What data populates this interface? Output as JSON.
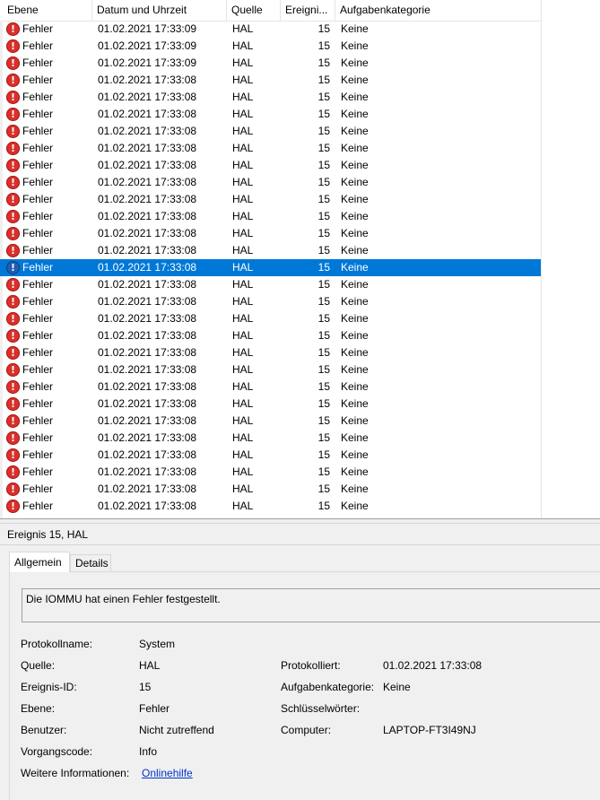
{
  "list": {
    "columns": [
      "Ebene",
      "Datum und Uhrzeit",
      "Quelle",
      "Ereigni...",
      "Aufgabenkategorie"
    ],
    "selected_index": 14,
    "rows": [
      {
        "level": "Fehler",
        "date": "01.02.2021 17:33:09",
        "source": "HAL",
        "id": "15",
        "category": "Keine"
      },
      {
        "level": "Fehler",
        "date": "01.02.2021 17:33:09",
        "source": "HAL",
        "id": "15",
        "category": "Keine"
      },
      {
        "level": "Fehler",
        "date": "01.02.2021 17:33:09",
        "source": "HAL",
        "id": "15",
        "category": "Keine"
      },
      {
        "level": "Fehler",
        "date": "01.02.2021 17:33:08",
        "source": "HAL",
        "id": "15",
        "category": "Keine"
      },
      {
        "level": "Fehler",
        "date": "01.02.2021 17:33:08",
        "source": "HAL",
        "id": "15",
        "category": "Keine"
      },
      {
        "level": "Fehler",
        "date": "01.02.2021 17:33:08",
        "source": "HAL",
        "id": "15",
        "category": "Keine"
      },
      {
        "level": "Fehler",
        "date": "01.02.2021 17:33:08",
        "source": "HAL",
        "id": "15",
        "category": "Keine"
      },
      {
        "level": "Fehler",
        "date": "01.02.2021 17:33:08",
        "source": "HAL",
        "id": "15",
        "category": "Keine"
      },
      {
        "level": "Fehler",
        "date": "01.02.2021 17:33:08",
        "source": "HAL",
        "id": "15",
        "category": "Keine"
      },
      {
        "level": "Fehler",
        "date": "01.02.2021 17:33:08",
        "source": "HAL",
        "id": "15",
        "category": "Keine"
      },
      {
        "level": "Fehler",
        "date": "01.02.2021 17:33:08",
        "source": "HAL",
        "id": "15",
        "category": "Keine"
      },
      {
        "level": "Fehler",
        "date": "01.02.2021 17:33:08",
        "source": "HAL",
        "id": "15",
        "category": "Keine"
      },
      {
        "level": "Fehler",
        "date": "01.02.2021 17:33:08",
        "source": "HAL",
        "id": "15",
        "category": "Keine"
      },
      {
        "level": "Fehler",
        "date": "01.02.2021 17:33:08",
        "source": "HAL",
        "id": "15",
        "category": "Keine"
      },
      {
        "level": "Fehler",
        "date": "01.02.2021 17:33:08",
        "source": "HAL",
        "id": "15",
        "category": "Keine"
      },
      {
        "level": "Fehler",
        "date": "01.02.2021 17:33:08",
        "source": "HAL",
        "id": "15",
        "category": "Keine"
      },
      {
        "level": "Fehler",
        "date": "01.02.2021 17:33:08",
        "source": "HAL",
        "id": "15",
        "category": "Keine"
      },
      {
        "level": "Fehler",
        "date": "01.02.2021 17:33:08",
        "source": "HAL",
        "id": "15",
        "category": "Keine"
      },
      {
        "level": "Fehler",
        "date": "01.02.2021 17:33:08",
        "source": "HAL",
        "id": "15",
        "category": "Keine"
      },
      {
        "level": "Fehler",
        "date": "01.02.2021 17:33:08",
        "source": "HAL",
        "id": "15",
        "category": "Keine"
      },
      {
        "level": "Fehler",
        "date": "01.02.2021 17:33:08",
        "source": "HAL",
        "id": "15",
        "category": "Keine"
      },
      {
        "level": "Fehler",
        "date": "01.02.2021 17:33:08",
        "source": "HAL",
        "id": "15",
        "category": "Keine"
      },
      {
        "level": "Fehler",
        "date": "01.02.2021 17:33:08",
        "source": "HAL",
        "id": "15",
        "category": "Keine"
      },
      {
        "level": "Fehler",
        "date": "01.02.2021 17:33:08",
        "source": "HAL",
        "id": "15",
        "category": "Keine"
      },
      {
        "level": "Fehler",
        "date": "01.02.2021 17:33:08",
        "source": "HAL",
        "id": "15",
        "category": "Keine"
      },
      {
        "level": "Fehler",
        "date": "01.02.2021 17:33:08",
        "source": "HAL",
        "id": "15",
        "category": "Keine"
      },
      {
        "level": "Fehler",
        "date": "01.02.2021 17:33:08",
        "source": "HAL",
        "id": "15",
        "category": "Keine"
      },
      {
        "level": "Fehler",
        "date": "01.02.2021 17:33:08",
        "source": "HAL",
        "id": "15",
        "category": "Keine"
      },
      {
        "level": "Fehler",
        "date": "01.02.2021 17:33:08",
        "source": "HAL",
        "id": "15",
        "category": "Keine"
      }
    ],
    "error_icon": "error-icon",
    "selection_color": "#0078d7"
  },
  "detail": {
    "title": "Ereignis 15, HAL",
    "tabs": [
      "Allgemein",
      "Details"
    ],
    "active_tab": "Allgemein",
    "description": "Die IOMMU hat einen Fehler festgestellt.",
    "labels": {
      "log_name": "Protokollname:",
      "source": "Quelle:",
      "event_id": "Ereignis-ID:",
      "level": "Ebene:",
      "user": "Benutzer:",
      "opcode": "Vorgangscode:",
      "more_info": "Weitere Informationen:",
      "logged": "Protokolliert:",
      "task_category": "Aufgabenkategorie:",
      "keywords": "Schlüsselwörter:",
      "computer": "Computer:"
    },
    "values": {
      "log_name": "System",
      "source": "HAL",
      "event_id": "15",
      "level": "Fehler",
      "user": "Nicht zutreffend",
      "opcode": "Info",
      "more_info_link": "Onlinehilfe",
      "logged": "01.02.2021 17:33:08",
      "task_category": "Keine",
      "keywords": "",
      "computer": "LAPTOP-FT3I49NJ"
    }
  }
}
